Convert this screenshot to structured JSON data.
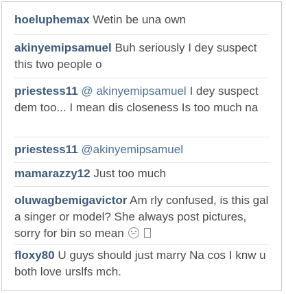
{
  "comments": [
    {
      "username": "hoeluphemax",
      "text": "Wetin be una own"
    },
    {
      "username": "akinyemipsamuel",
      "text": "Buh seriously I dey suspect this two people o"
    },
    {
      "username": "priestess11",
      "mention": "@ akinyemipsamuel",
      "text": "I dey suspect dem too... I mean dis closeness Is too much na"
    },
    {
      "username": "priestess11",
      "mention": "@akinyemipsamuel",
      "text": ""
    },
    {
      "username": "mamarazzy12",
      "text": "Just too much"
    },
    {
      "username": "oluwagbemigavictor",
      "text": "Am rly confused, is this gal a singer or model? She always post pictures, sorry for bin so mean"
    },
    {
      "username": "floxy80",
      "text": "U guys should just marry Na cos I knw u both love urslfs mch."
    }
  ],
  "icons": {
    "emoji": "sad-face-emoji-icon",
    "glyph": "missing-glyph-icon"
  }
}
